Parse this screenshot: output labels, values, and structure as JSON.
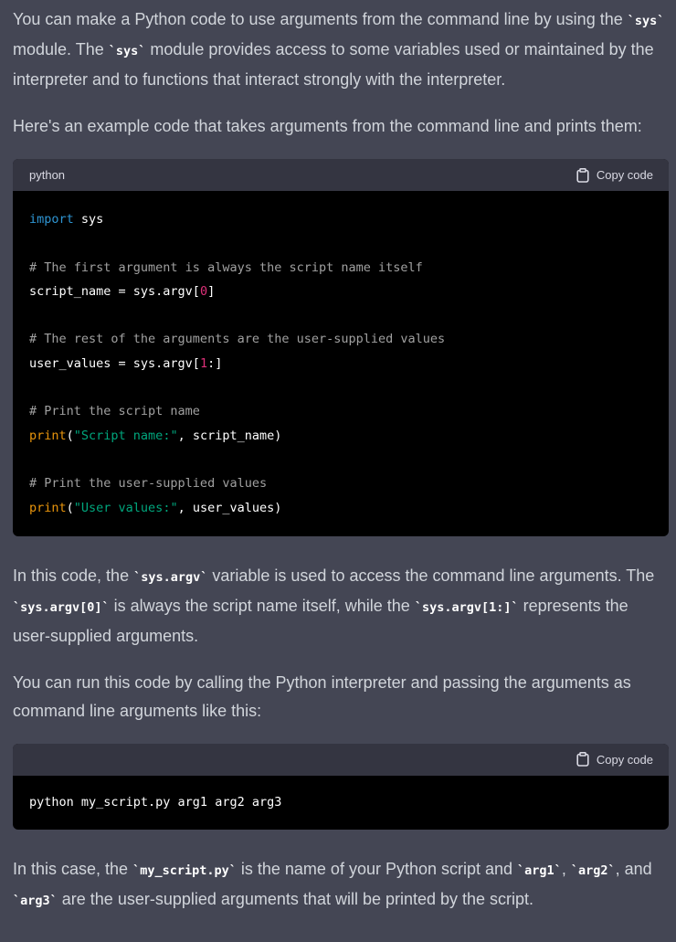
{
  "para1": {
    "t1": "You can make a Python code to use arguments from the command line by using the ",
    "c1": "`sys`",
    "t2": " module. The ",
    "c2": "`sys`",
    "t3": " module provides access to some variables used or maintained by the interpreter and to functions that interact strongly with the interpreter."
  },
  "para2": "Here's an example code that takes arguments from the command line and prints them:",
  "code1": {
    "language": "python",
    "copy_label": "Copy code",
    "lines": {
      "l1_kw": "import",
      "l1_rest": " sys",
      "l3": "# The first argument is always the script name itself",
      "l4_a": "script_name = sys.argv[",
      "l4_num": "0",
      "l4_b": "]",
      "l6": "# The rest of the arguments are the user-supplied values",
      "l7_a": "user_values = sys.argv[",
      "l7_num": "1",
      "l7_b": ":]",
      "l9": "# Print the script name",
      "l10_fn": "print",
      "l10_a": "(",
      "l10_str": "\"Script name:\"",
      "l10_b": ", script_name)",
      "l12": "# Print the user-supplied values",
      "l13_fn": "print",
      "l13_a": "(",
      "l13_str": "\"User values:\"",
      "l13_b": ", user_values)"
    }
  },
  "para3": {
    "t1": "In this code, the ",
    "c1": "`sys.argv`",
    "t2": " variable is used to access the command line arguments. The ",
    "c2": "`sys.argv[0]`",
    "t3": " is always the script name itself, while the ",
    "c3": "`sys.argv[1:]`",
    "t4": " represents the user-supplied arguments."
  },
  "para4": "You can run this code by calling the Python interpreter and passing the arguments as command line arguments like this:",
  "code2": {
    "copy_label": "Copy code",
    "line": "python my_script.py arg1 arg2 arg3"
  },
  "para5": {
    "t1": "In this case, the ",
    "c1": "`my_script.py`",
    "t2": " is the name of your Python script and ",
    "c2": "`arg1`",
    "t3": ", ",
    "c3": "`arg2`",
    "t4": ", and ",
    "c4": "`arg3`",
    "t5": " are the user-supplied arguments that will be printed by the script."
  }
}
